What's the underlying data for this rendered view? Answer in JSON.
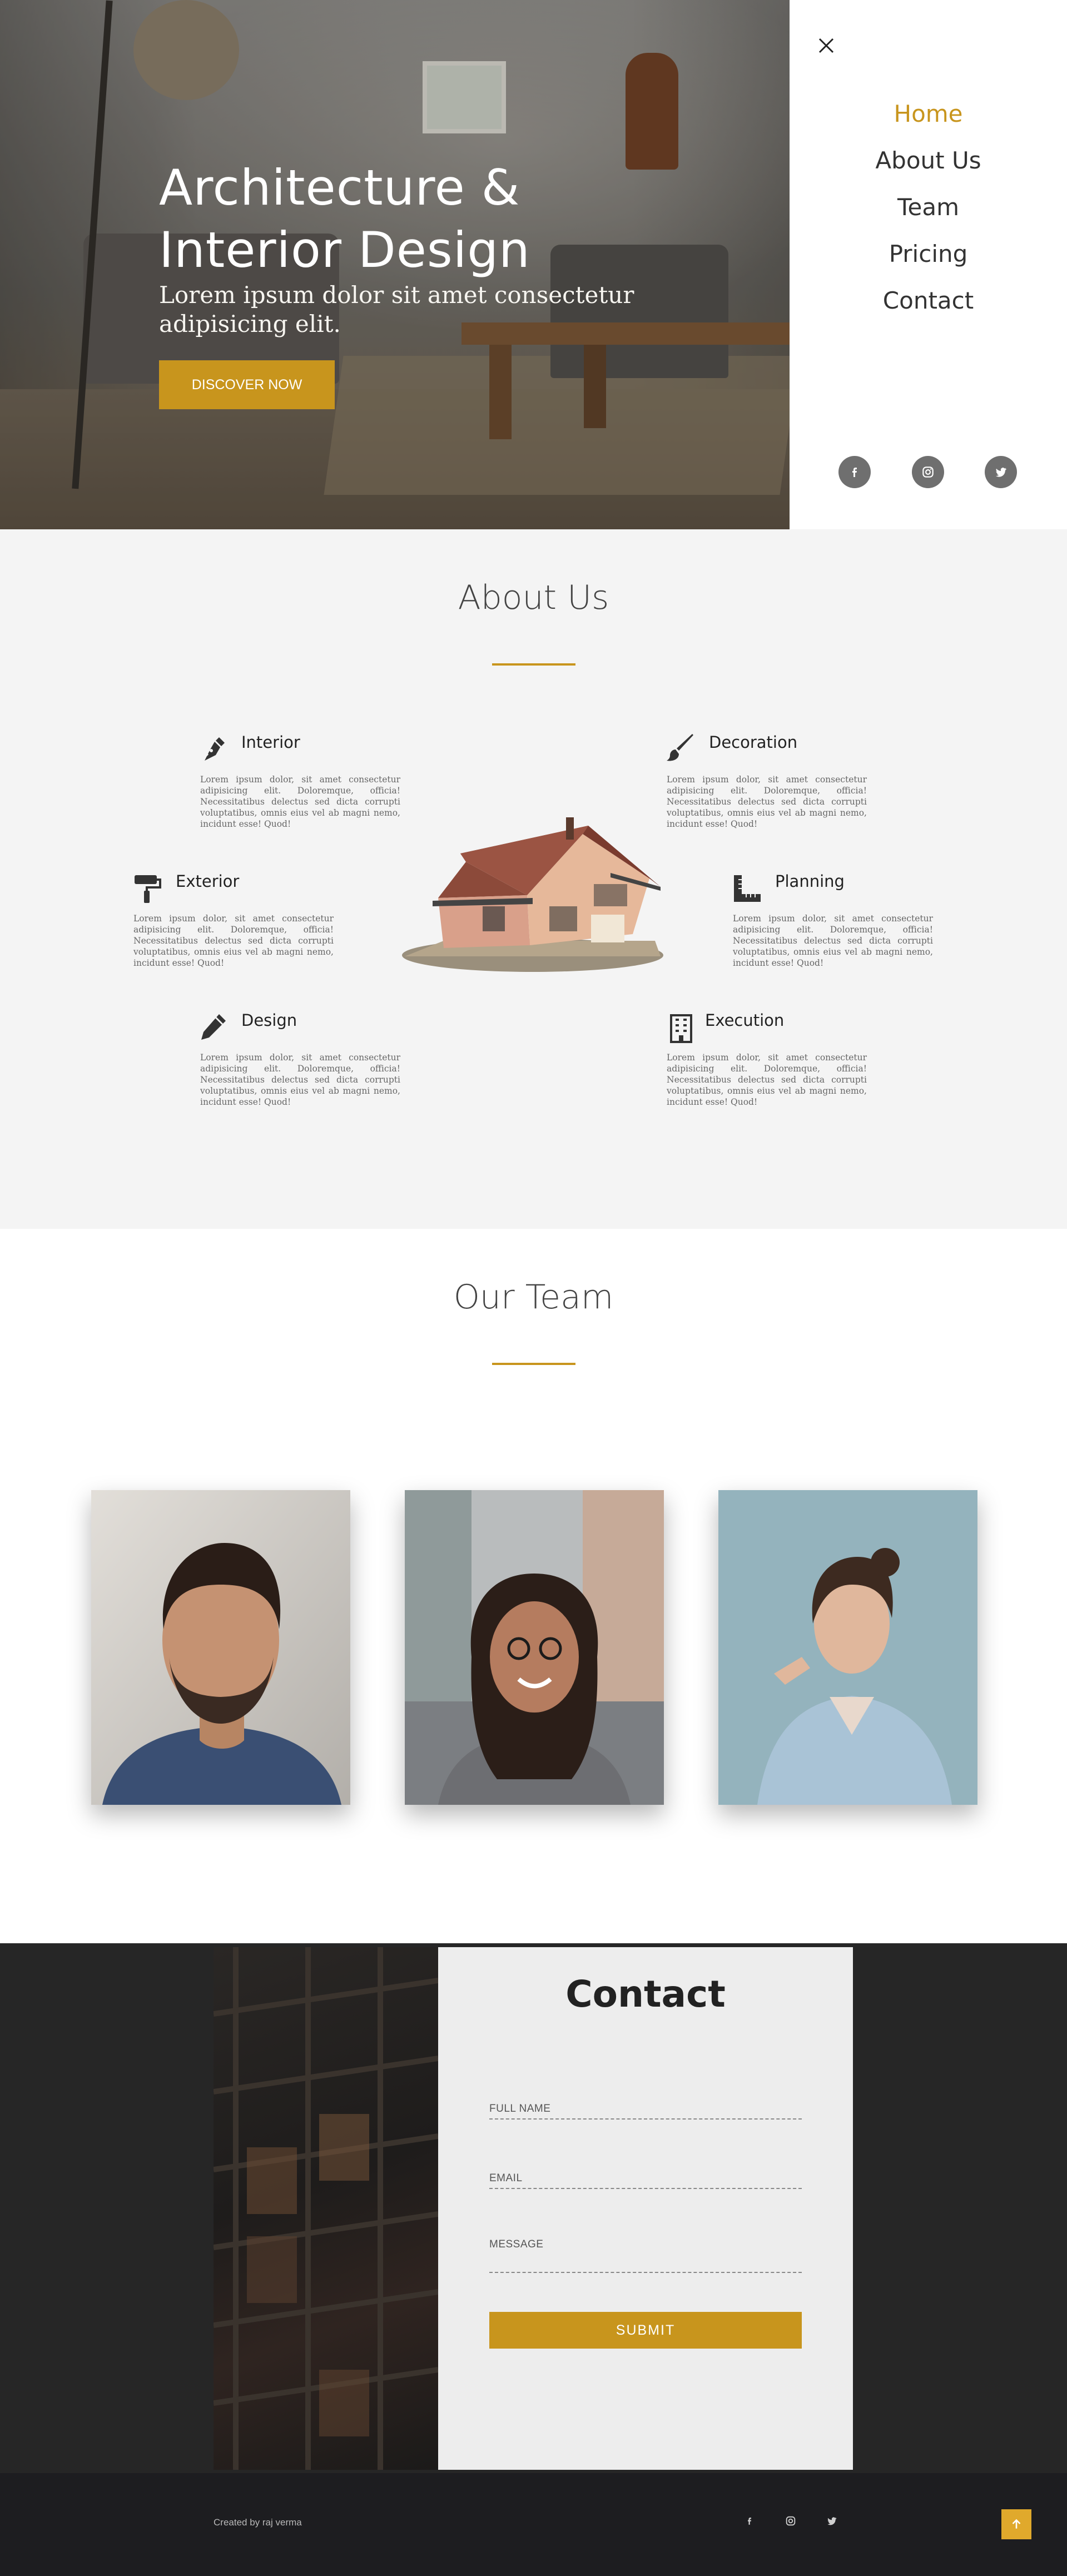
{
  "hero": {
    "title_line1": "Architecture &",
    "title_line2": "Interior Design",
    "subtitle_line1": "Lorem ipsum dolor sit amet consectetur",
    "subtitle_line2": "adipisicing elit.",
    "cta_label": "DISCOVER NOW"
  },
  "nav": {
    "items": [
      {
        "label": "Home",
        "active": true
      },
      {
        "label": "About Us",
        "active": false
      },
      {
        "label": "Team",
        "active": false
      },
      {
        "label": "Pricing",
        "active": false
      },
      {
        "label": "Contact",
        "active": false
      }
    ],
    "social": [
      "facebook-icon",
      "instagram-icon",
      "twitter-icon"
    ]
  },
  "about": {
    "title": "About Us",
    "features": [
      {
        "title": "Interior",
        "icon": "pen-nib-icon",
        "text": "Lorem ipsum dolor, sit amet consectetur adipisicing elit. Doloremque, officia! Necessitatibus delectus sed dicta corrupti voluptatibus, omnis eius vel ab magni nemo, incidunt esse! Quod!"
      },
      {
        "title": "Decoration",
        "icon": "paint-brush-icon",
        "text": "Lorem ipsum dolor, sit amet consectetur adipisicing elit. Doloremque, officia! Necessitatibus delectus sed dicta corrupti voluptatibus, omnis eius vel ab magni nemo, incidunt esse! Quod!"
      },
      {
        "title": "Exterior",
        "icon": "paint-roller-icon",
        "text": "Lorem ipsum dolor, sit amet consectetur adipisicing elit. Doloremque, officia! Necessitatibus delectus sed dicta corrupti voluptatibus, omnis eius vel ab magni nemo, incidunt esse! Quod!"
      },
      {
        "title": "Planning",
        "icon": "ruler-combined-icon",
        "text": "Lorem ipsum dolor, sit amet consectetur adipisicing elit. Doloremque, officia! Necessitatibus delectus sed dicta corrupti voluptatibus, omnis eius vel ab magni nemo, incidunt esse! Quod!"
      },
      {
        "title": "Design",
        "icon": "pencil-icon",
        "text": "Lorem ipsum dolor, sit amet consectetur adipisicing elit. Doloremque, officia! Necessitatibus delectus sed dicta corrupti voluptatibus, omnis eius vel ab magni nemo, incidunt esse! Quod!"
      },
      {
        "title": "Execution",
        "icon": "building-icon",
        "text": "Lorem ipsum dolor, sit amet consectetur adipisicing elit. Doloremque, officia! Necessitatibus delectus sed dicta corrupti voluptatibus, omnis eius vel ab magni nemo, incidunt esse! Quod!"
      }
    ]
  },
  "team": {
    "title": "Our Team"
  },
  "contact": {
    "title": "Contact",
    "fields": [
      {
        "label": "FULL NAME",
        "value": ""
      },
      {
        "label": "EMAIL",
        "value": ""
      },
      {
        "label": "MESSAGE",
        "value": ""
      }
    ],
    "submit_label": "SUBMIT"
  },
  "footer": {
    "credit": "Created by raj verma"
  },
  "colors": {
    "accent": "#c8951d",
    "dark": "#262626",
    "footer": "#1d1d20"
  }
}
